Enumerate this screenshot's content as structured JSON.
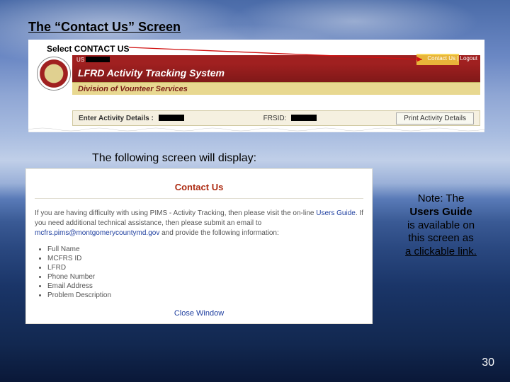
{
  "slide": {
    "title": "The “Contact Us” Screen",
    "following": "The following screen will display:",
    "page_number": "30"
  },
  "shot1": {
    "select_label": "Select CONTACT US",
    "user_prefix": "US",
    "app_title": "LFRD Activity Tracking System",
    "division": "Division of Vounteer Services",
    "nav": {
      "contact": "Contact Us",
      "logout": "Logout"
    },
    "details": {
      "enter_label": "Enter Activity Details :",
      "frsid_label": "FRSID:",
      "print_label": "Print Activity Details"
    }
  },
  "shot2": {
    "heading": "Contact Us",
    "help_pre": "If you are having difficulty with using PIMS - Activity Tracking, then please visit the on-line ",
    "users_guide": "Users Guide",
    "help_mid": ". If you need additional technical assistance, then please submit an email to ",
    "email": "mcfrs.pims@montgomerycountymd.gov",
    "help_post": " and provide the following information:",
    "bullets": [
      "Full Name",
      "MCFRS ID",
      "LFRD",
      "Phone Number",
      "Email Address",
      "Problem Description"
    ],
    "close": "Close Window"
  },
  "note": {
    "l1": "Note:  The",
    "l2": "Users Guide",
    "l3": "is available on",
    "l4": "this screen as",
    "l5": "a clickable link."
  }
}
